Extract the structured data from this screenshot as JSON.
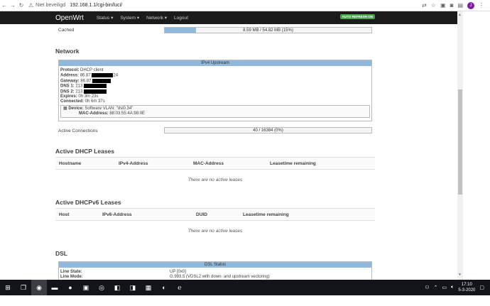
{
  "browser": {
    "security_label": "Niet beveiligd",
    "url": "192.168.1.1/cgi-bin/luci/",
    "profile_initial": "J"
  },
  "nav": {
    "brand": "OpenWrt",
    "items": [
      "Status ▾",
      "System ▾",
      "Network ▾",
      "Logout"
    ],
    "autorefresh": "AUTO REFRESH ON"
  },
  "memory": {
    "cached_label": "Cached",
    "cached_value": "8.59 MB / 54.82 MB (15%)",
    "cached_fraction": 0.15
  },
  "network": {
    "title": "Network",
    "ipv4_header": "IPv4 Upstream",
    "protocol": "DHCP client",
    "address_start": "86.87.",
    "address_end": "24",
    "gateway_start": "86.87.",
    "dns1_start": "213.",
    "dns2_start": "213.",
    "expires": "0h 3m 23s",
    "connected": "0h 6m 37s",
    "device": "Software VLAN: \"dsl0.34\"",
    "mac": "88:03:55:4A:98:0E",
    "labels": {
      "protocol": "Protocol:",
      "address": "Address:",
      "gateway": "Gateway:",
      "dns1": "DNS 1:",
      "dns2": "DNS 2:",
      "expires": "Expires:",
      "connected": "Connected:",
      "device": "Device:",
      "mac": "MAC-Address:"
    },
    "active_conn_label": "Active Connections",
    "active_conn_value": "40 / 16384 (0%)",
    "active_conn_fraction": 0.0
  },
  "dhcp": {
    "title": "Active DHCP Leases",
    "columns": [
      "Hostname",
      "IPv4-Address",
      "MAC-Address",
      "Leasetime remaining"
    ],
    "empty": "There are no active leases"
  },
  "dhcpv6": {
    "title": "Active DHCPv6 Leases",
    "columns": [
      "Host",
      "IPv6-Address",
      "DUID",
      "Leasetime remaining"
    ],
    "empty": "There are no active leases"
  },
  "dsl": {
    "title": "DSL",
    "header": "DSL Status",
    "line_state_label": "Line State:",
    "line_state_value": "UP [0x0]",
    "line_mode_label": "Line Mode:",
    "line_mode_value": "G.993.5 (VDSL2 with down- and upstream vectoring)"
  },
  "taskbar": {
    "time": "17:10",
    "date": "5-3-2020"
  }
}
